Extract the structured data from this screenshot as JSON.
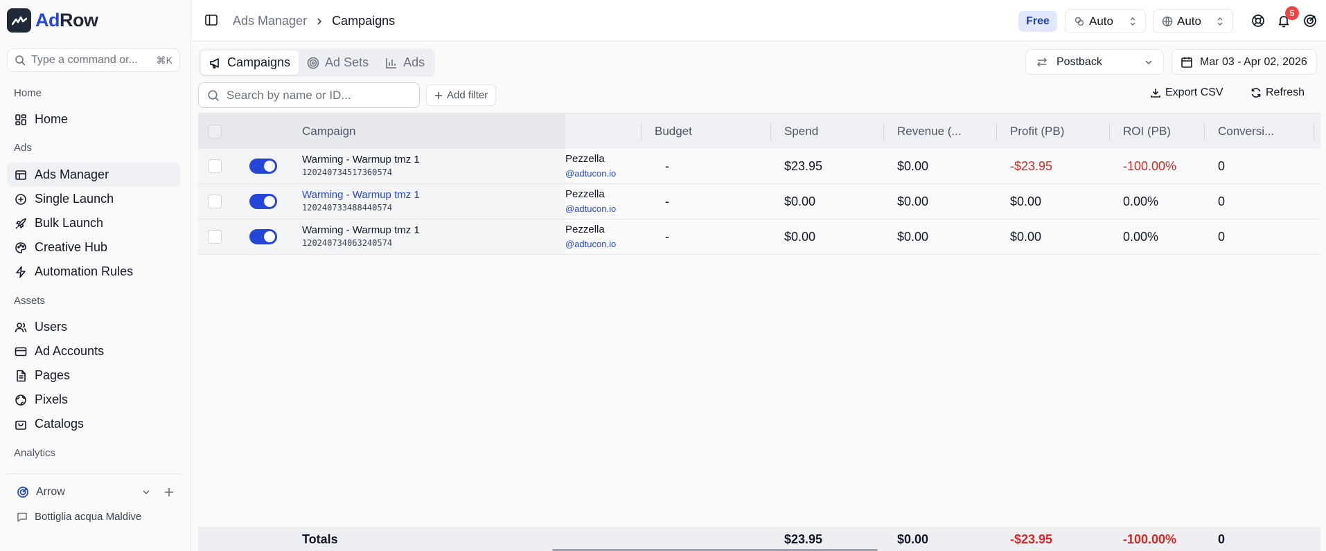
{
  "app": {
    "brand_prefix": "Ad",
    "brand_suffix": "Row"
  },
  "sidebar": {
    "command_placeholder": "Type a command or...",
    "command_shortcut": "⌘K",
    "sections": {
      "home": "Home",
      "ads": "Ads",
      "assets": "Assets",
      "analytics": "Analytics"
    },
    "items": [
      {
        "label": "Home",
        "icon": "dashboard-icon"
      },
      {
        "label": "Ads Manager",
        "icon": "layers-icon",
        "active": true
      },
      {
        "label": "Single Launch",
        "icon": "plus-circle-icon"
      },
      {
        "label": "Bulk Launch",
        "icon": "rocket-icon"
      },
      {
        "label": "Creative Hub",
        "icon": "palette-icon"
      },
      {
        "label": "Automation Rules",
        "icon": "bolt-icon"
      },
      {
        "label": "Users",
        "icon": "users-icon"
      },
      {
        "label": "Ad Accounts",
        "icon": "credit-card-icon"
      },
      {
        "label": "Pages",
        "icon": "file-icon"
      },
      {
        "label": "Pixels",
        "icon": "globe-icon"
      },
      {
        "label": "Catalogs",
        "icon": "shopping-bag-icon"
      }
    ],
    "workspace": {
      "name": "Arrow",
      "sub_item": "Bottiglia acqua Maldive"
    }
  },
  "topbar": {
    "breadcrumb": [
      "Ads Manager",
      "Campaigns"
    ],
    "plan_badge": "Free",
    "attribution_select": "Auto",
    "timezone_select": "Auto",
    "notification_count": "5"
  },
  "toolbar": {
    "tabs": [
      {
        "label": "Campaigns",
        "active": true
      },
      {
        "label": "Ad Sets"
      },
      {
        "label": "Ads"
      }
    ],
    "postback_select": "Postback",
    "date_range": "Mar 03 - Apr 02, 2026",
    "search_placeholder": "Search by name or ID...",
    "add_filter": "Add filter",
    "export_label": "Export CSV",
    "refresh_label": "Refresh"
  },
  "table": {
    "columns": {
      "campaign": "Campaign",
      "budget": "Budget",
      "spend": "Spend",
      "revenue": "Revenue (...",
      "profit": "Profit (PB)",
      "roi": "ROI (PB)",
      "conversions": "Conversi..."
    },
    "rows": [
      {
        "name": "Warming - Warmup tmz 1",
        "id": "120240734517360574",
        "owner": "Pezzella",
        "owner_email": "@adtucon.io",
        "budget": "-",
        "spend": "$23.95",
        "revenue": "$0.00",
        "profit": "-$23.95",
        "roi": "-100.00%",
        "conversions": "0"
      },
      {
        "name": "Warming - Warmup tmz 1",
        "id": "120240733488440574",
        "owner": "Pezzella",
        "owner_email": "@adtucon.io",
        "budget": "-",
        "spend": "$0.00",
        "revenue": "$0.00",
        "profit": "$0.00",
        "roi": "0.00%",
        "conversions": "0"
      },
      {
        "name": "Warming - Warmup tmz 1",
        "id": "120240734063240574",
        "owner": "Pezzella",
        "owner_email": "@adtucon.io",
        "budget": "-",
        "spend": "$0.00",
        "revenue": "$0.00",
        "profit": "$0.00",
        "roi": "0.00%",
        "conversions": "0"
      }
    ],
    "totals": {
      "label": "Totals",
      "spend": "$23.95",
      "revenue": "$0.00",
      "profit": "-$23.95",
      "roi": "-100.00%",
      "conversions": "0"
    }
  },
  "colors": {
    "accent": "#2547d8",
    "negative": "#dc2626",
    "badge": "#ef4444"
  }
}
